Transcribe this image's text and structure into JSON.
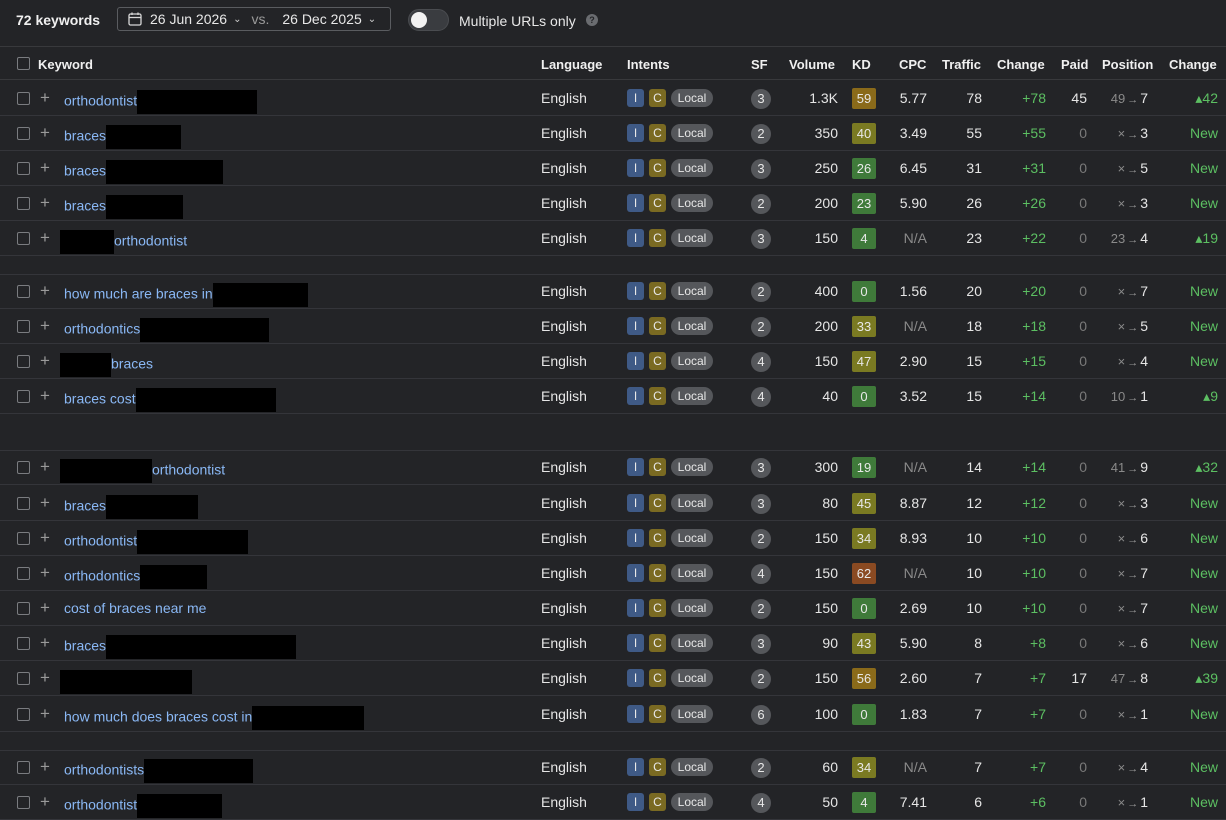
{
  "topbar": {
    "keyword_count": "72 keywords",
    "date_from": "26 Jun 2026",
    "vs": "vs.",
    "date_to": "26 Dec 2025",
    "toggle_label": "Multiple URLs only",
    "toggle_on": false
  },
  "columns": {
    "keyword": "Keyword",
    "language": "Language",
    "intents": "Intents",
    "sf": "SF",
    "volume": "Volume",
    "kd": "KD",
    "cpc": "CPC",
    "traffic": "Traffic",
    "change": "Change",
    "paid": "Paid",
    "position": "Position",
    "pos_change": "Change"
  },
  "intent_labels": {
    "informational": "I",
    "commercial": "C",
    "local": "Local"
  },
  "colors": {
    "link": "#8ab8f5",
    "positive": "#5cbf62",
    "kd_green": "#3f7a3a",
    "kd_olive": "#7a7a22",
    "kd_amber": "#8a6a1a",
    "kd_orange": "#8a4a22"
  },
  "rows": [
    {
      "kw1": "orthodontist",
      "redact": 120,
      "kw2": "",
      "lang": "English",
      "sf": "3",
      "vol": "1.3K",
      "kd": "59",
      "kdc": "kd_amber",
      "cpc": "5.77",
      "traf": "78",
      "chg": "+78",
      "paid": "45",
      "from": "49",
      "to": "7",
      "pchg": "▴42"
    },
    {
      "kw1": "braces",
      "redact": 75,
      "kw2": "",
      "lang": "English",
      "sf": "2",
      "vol": "350",
      "kd": "40",
      "kdc": "kd_olive",
      "cpc": "3.49",
      "traf": "55",
      "chg": "+55",
      "paid": "0",
      "from": "×",
      "to": "3",
      "pchg": "New"
    },
    {
      "kw1": "braces",
      "redact": 117,
      "kw2": "",
      "lang": "English",
      "sf": "3",
      "vol": "250",
      "kd": "26",
      "kdc": "kd_green",
      "cpc": "6.45",
      "traf": "31",
      "chg": "+31",
      "paid": "0",
      "from": "×",
      "to": "5",
      "pchg": "New"
    },
    {
      "kw1": "braces",
      "redact": 77,
      "kw2": "",
      "lang": "English",
      "sf": "2",
      "vol": "200",
      "kd": "23",
      "kdc": "kd_green",
      "cpc": "5.90",
      "traf": "26",
      "chg": "+26",
      "paid": "0",
      "from": "×",
      "to": "3",
      "pchg": "New"
    },
    {
      "kw1": "",
      "redact": 54,
      "kw2": "orthodontist",
      "lang": "English",
      "sf": "3",
      "vol": "150",
      "kd": "4",
      "kdc": "kd_green",
      "cpc": "N/A",
      "traf": "23",
      "chg": "+22",
      "paid": "0",
      "from": "23",
      "to": "4",
      "pchg": "▴19"
    },
    {
      "kw1": "how much are braces in",
      "redact": 95,
      "kw2": "",
      "lang": "English",
      "sf": "2",
      "vol": "400",
      "kd": "0",
      "kdc": "kd_green",
      "cpc": "1.56",
      "traf": "20",
      "chg": "+20",
      "paid": "0",
      "from": "×",
      "to": "7",
      "pchg": "New"
    },
    {
      "kw1": "orthodontics",
      "redact": 129,
      "kw2": "",
      "lang": "English",
      "sf": "2",
      "vol": "200",
      "kd": "33",
      "kdc": "kd_olive",
      "cpc": "N/A",
      "traf": "18",
      "chg": "+18",
      "paid": "0",
      "from": "×",
      "to": "5",
      "pchg": "New"
    },
    {
      "kw1": "",
      "redact": 51,
      "kw2": "braces",
      "lang": "English",
      "sf": "4",
      "vol": "150",
      "kd": "47",
      "kdc": "kd_olive",
      "cpc": "2.90",
      "traf": "15",
      "chg": "+15",
      "paid": "0",
      "from": "×",
      "to": "4",
      "pchg": "New"
    },
    {
      "kw1": "braces cost",
      "redact": 140,
      "kw2": "",
      "lang": "English",
      "sf": "4",
      "vol": "40",
      "kd": "0",
      "kdc": "kd_green",
      "cpc": "3.52",
      "traf": "15",
      "chg": "+14",
      "paid": "0",
      "from": "10",
      "to": "1",
      "pchg": "▴9"
    },
    {
      "kw1": "",
      "redact": 92,
      "kw2": "orthodontist",
      "lang": "English",
      "sf": "3",
      "vol": "300",
      "kd": "19",
      "kdc": "kd_green",
      "cpc": "N/A",
      "traf": "14",
      "chg": "+14",
      "paid": "0",
      "from": "41",
      "to": "9",
      "pchg": "▴32"
    },
    {
      "kw1": "braces",
      "redact": 92,
      "kw2": "",
      "lang": "English",
      "sf": "3",
      "vol": "80",
      "kd": "45",
      "kdc": "kd_olive",
      "cpc": "8.87",
      "traf": "12",
      "chg": "+12",
      "paid": "0",
      "from": "×",
      "to": "3",
      "pchg": "New"
    },
    {
      "kw1": "orthodontist",
      "redact": 111,
      "kw2": "",
      "lang": "English",
      "sf": "2",
      "vol": "150",
      "kd": "34",
      "kdc": "kd_olive",
      "cpc": "8.93",
      "traf": "10",
      "chg": "+10",
      "paid": "0",
      "from": "×",
      "to": "6",
      "pchg": "New"
    },
    {
      "kw1": "orthodontics",
      "redact": 67,
      "kw2": "",
      "lang": "English",
      "sf": "4",
      "vol": "150",
      "kd": "62",
      "kdc": "kd_orange",
      "cpc": "N/A",
      "traf": "10",
      "chg": "+10",
      "paid": "0",
      "from": "×",
      "to": "7",
      "pchg": "New"
    },
    {
      "kw1": "cost of braces near me",
      "redact": 0,
      "kw2": "",
      "lang": "English",
      "sf": "2",
      "vol": "150",
      "kd": "0",
      "kdc": "kd_green",
      "cpc": "2.69",
      "traf": "10",
      "chg": "+10",
      "paid": "0",
      "from": "×",
      "to": "7",
      "pchg": "New"
    },
    {
      "kw1": "braces",
      "redact": 190,
      "kw2": "",
      "lang": "English",
      "sf": "3",
      "vol": "90",
      "kd": "43",
      "kdc": "kd_olive",
      "cpc": "5.90",
      "traf": "8",
      "chg": "+8",
      "paid": "0",
      "from": "×",
      "to": "6",
      "pchg": "New"
    },
    {
      "kw1": "",
      "redact": 132,
      "kw2": "",
      "lang": "English",
      "sf": "2",
      "vol": "150",
      "kd": "56",
      "kdc": "kd_amber",
      "cpc": "2.60",
      "traf": "7",
      "chg": "+7",
      "paid": "17",
      "from": "47",
      "to": "8",
      "pchg": "▴39"
    },
    {
      "kw1": "how much does braces cost in",
      "redact": 112,
      "kw2": "",
      "lang": "English",
      "sf": "6",
      "vol": "100",
      "kd": "0",
      "kdc": "kd_green",
      "cpc": "1.83",
      "traf": "7",
      "chg": "+7",
      "paid": "0",
      "from": "×",
      "to": "1",
      "pchg": "New"
    },
    {
      "kw1": "orthodontists",
      "redact": 109,
      "kw2": "",
      "lang": "English",
      "sf": "2",
      "vol": "60",
      "kd": "34",
      "kdc": "kd_olive",
      "cpc": "N/A",
      "traf": "7",
      "chg": "+7",
      "paid": "0",
      "from": "×",
      "to": "4",
      "pchg": "New"
    },
    {
      "kw1": "orthodontist",
      "redact": 85,
      "kw2": "",
      "lang": "English",
      "sf": "4",
      "vol": "50",
      "kd": "4",
      "kdc": "kd_green",
      "cpc": "7.41",
      "traf": "6",
      "chg": "+6",
      "paid": "0",
      "from": "×",
      "to": "1",
      "pchg": "New"
    }
  ]
}
